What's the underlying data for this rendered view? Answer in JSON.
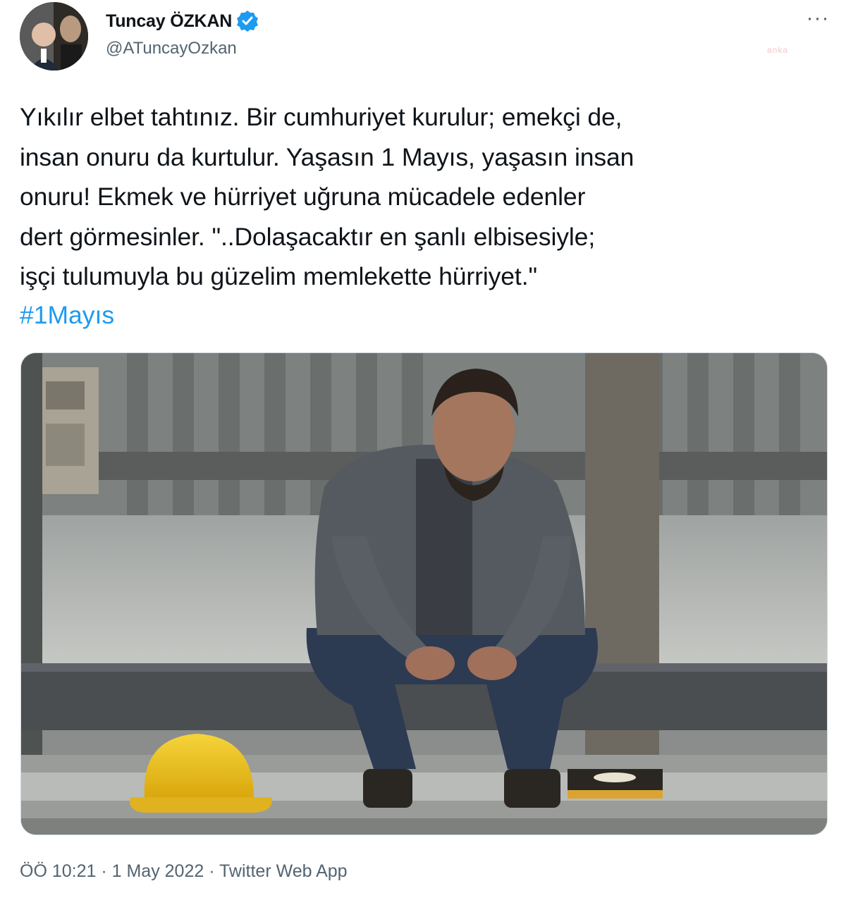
{
  "author": {
    "display_name": "Tuncay ÖZKAN",
    "handle": "@ATuncayOzkan",
    "verified_icon": "verified-badge-icon",
    "avatar_icon": "avatar"
  },
  "watermark": "anka",
  "more_icon": "more-dots-icon",
  "tweet": {
    "text": "Yıkılır elbet tahtınız. Bir cumhuriyet kurulur; emekçi de,\ninsan onuru da kurtulur. Yaşasın 1 Mayıs, yaşasın insan\nonuru! Ekmek ve hürriyet uğruna mücadele edenler\ndert görmesinler. \"..Dolaşacaktır en şanlı elbisesiyle;\nişçi tulumuyla bu güzelim memlekette hürriyet.\"",
    "hashtag": "#1Mayıs"
  },
  "metadata": {
    "timestamp": "ÖÖ 10:21 · 1 May 2022 · Twitter Web App"
  },
  "colors": {
    "text": "#0f1419",
    "secondary": "#536471",
    "accent": "#1d9bf0"
  }
}
